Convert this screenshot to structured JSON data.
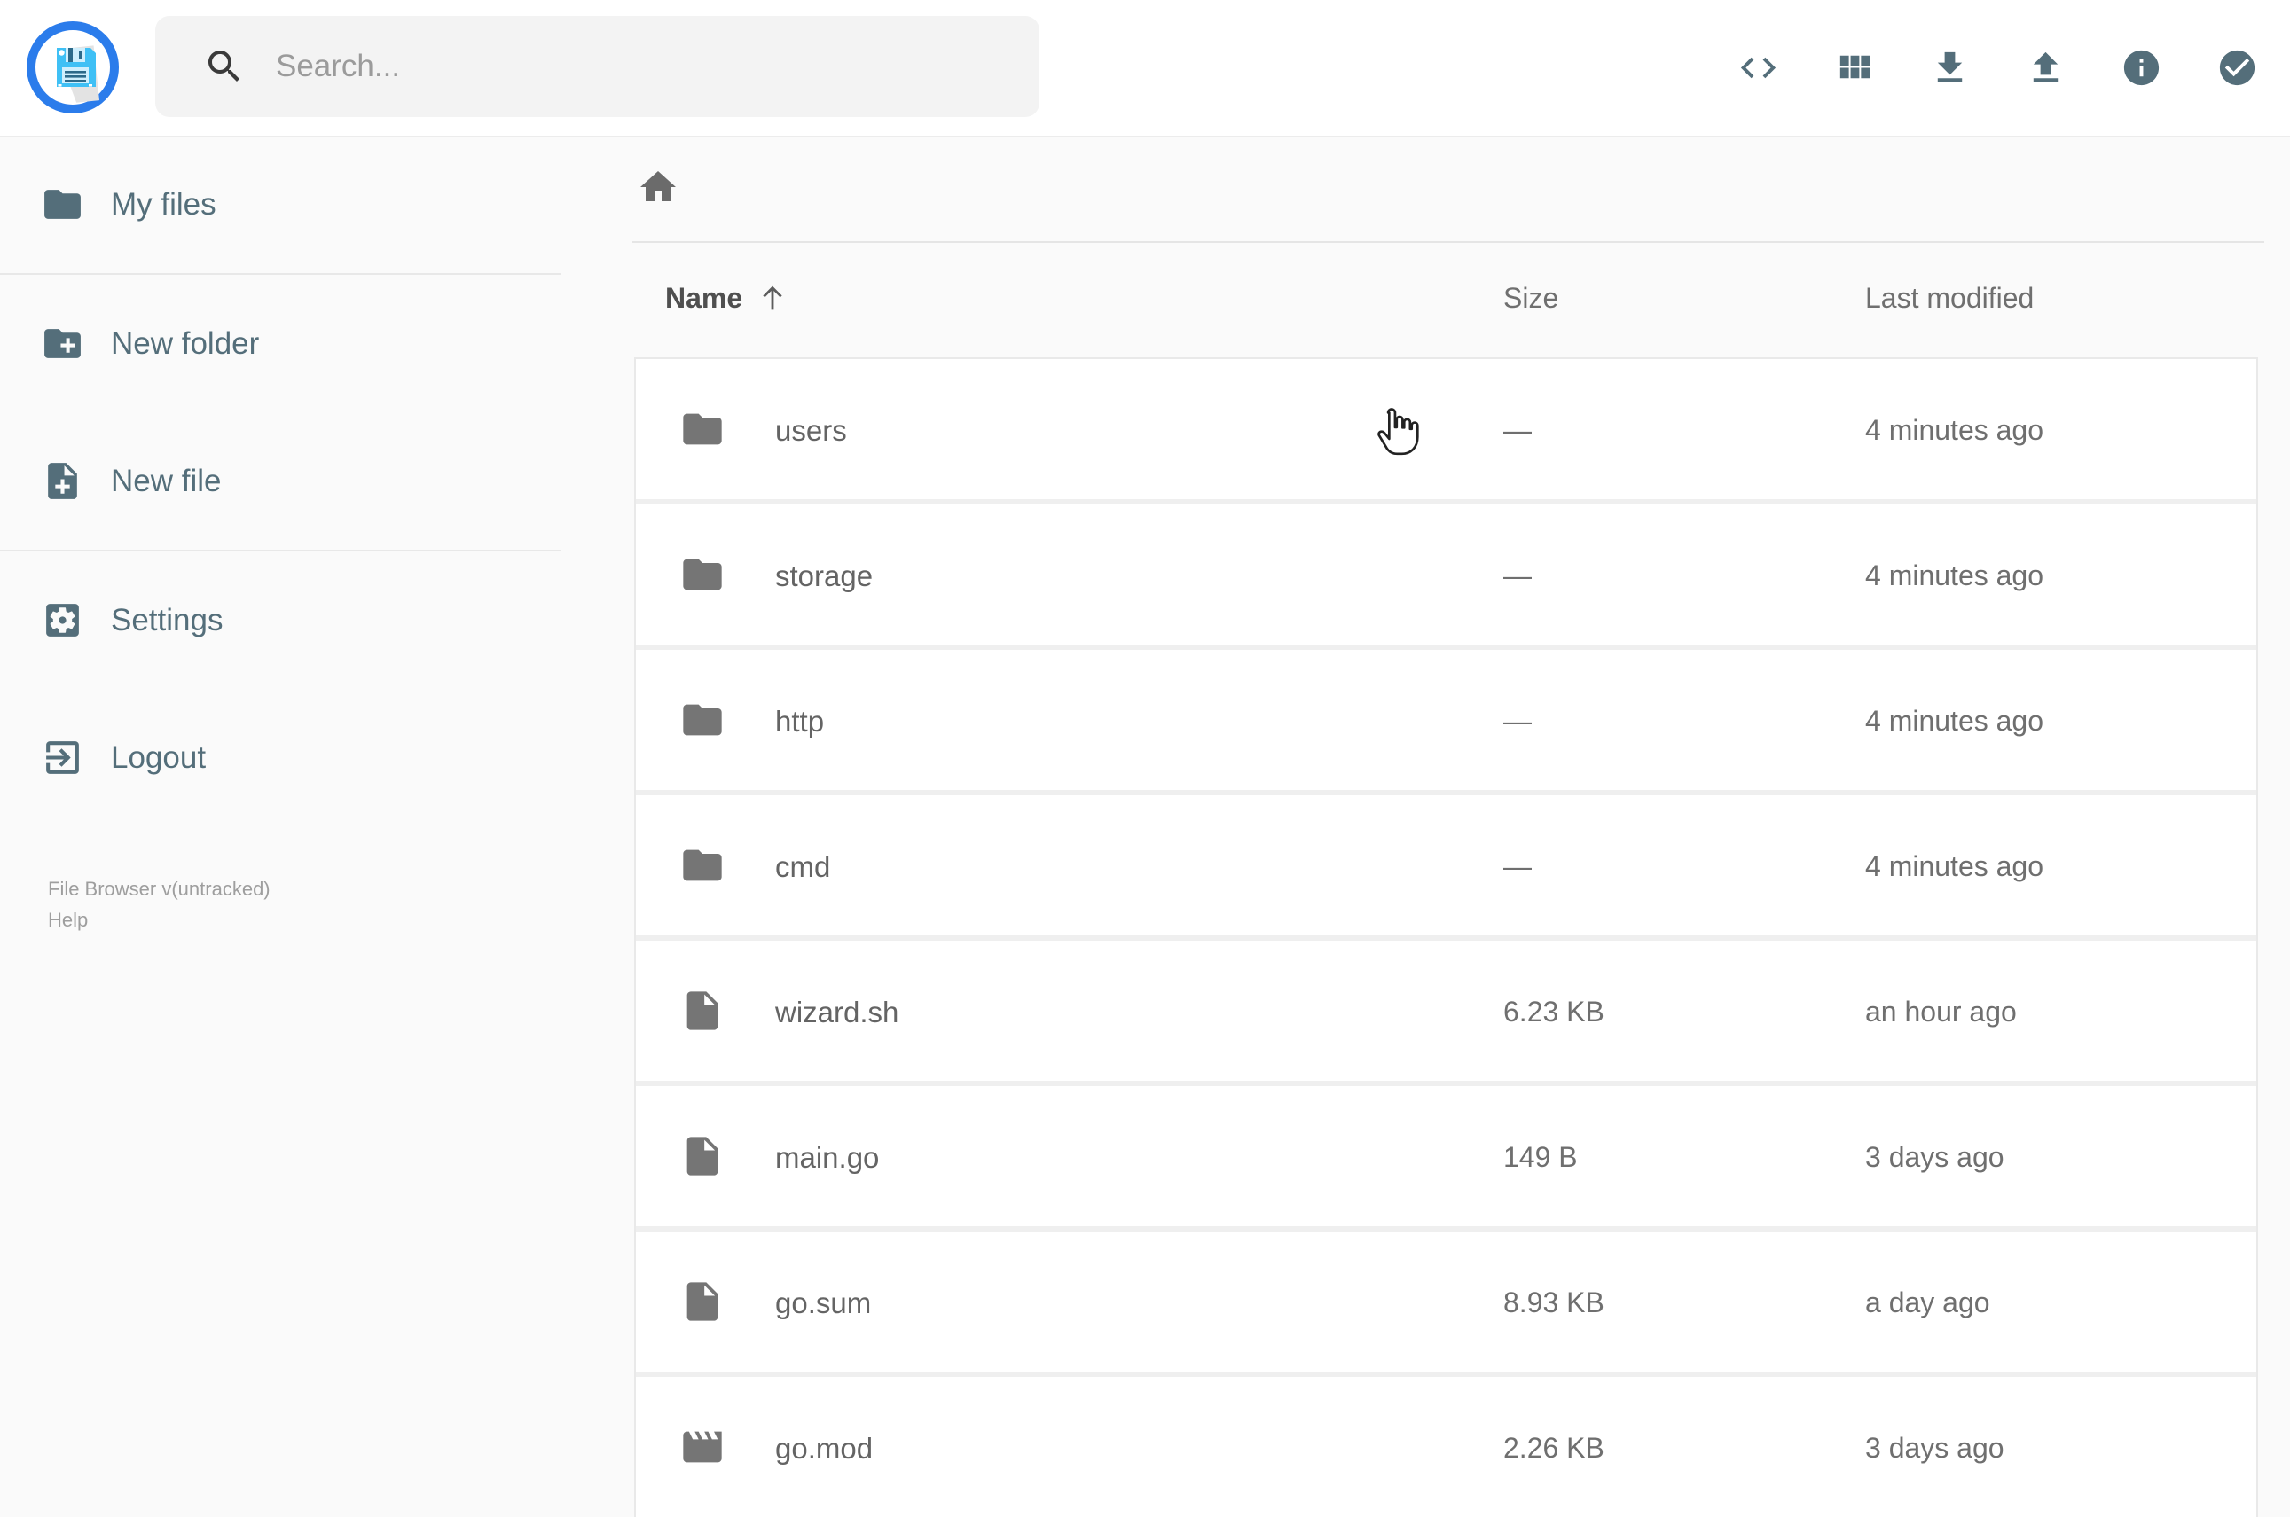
{
  "header": {
    "search": {
      "placeholder": "Search...",
      "value": ""
    },
    "actions": [
      {
        "icon": "code-view-icon"
      },
      {
        "icon": "grid-view-icon"
      },
      {
        "icon": "download-icon"
      },
      {
        "icon": "upload-icon"
      },
      {
        "icon": "info-icon"
      },
      {
        "icon": "select-multiple-icon"
      }
    ],
    "accent_color": "#2b7ceb",
    "icon_color": "#546e7a"
  },
  "sidebar": {
    "items": [
      {
        "label": "My files",
        "icon": "folder-icon"
      },
      {
        "label": "New folder",
        "icon": "create-new-folder-icon"
      },
      {
        "label": "New file",
        "icon": "new-file-icon"
      },
      {
        "label": "Settings",
        "icon": "settings-icon"
      },
      {
        "label": "Logout",
        "icon": "logout-icon"
      }
    ],
    "footer": {
      "version": "File Browser v(untracked)",
      "help": "Help"
    }
  },
  "listing": {
    "columns": {
      "name": "Name",
      "size": "Size",
      "modified": "Last modified"
    },
    "sort": {
      "column": "name",
      "direction": "asc"
    },
    "rows": [
      {
        "name": "users",
        "icon": "folder",
        "size": "—",
        "modified": "4 minutes ago"
      },
      {
        "name": "storage",
        "icon": "folder",
        "size": "—",
        "modified": "4 minutes ago"
      },
      {
        "name": "http",
        "icon": "folder",
        "size": "—",
        "modified": "4 minutes ago"
      },
      {
        "name": "cmd",
        "icon": "folder",
        "size": "—",
        "modified": "4 minutes ago"
      },
      {
        "name": "wizard.sh",
        "icon": "file",
        "size": "6.23 KB",
        "modified": "an hour ago"
      },
      {
        "name": "main.go",
        "icon": "file",
        "size": "149 B",
        "modified": "3 days ago"
      },
      {
        "name": "go.sum",
        "icon": "file",
        "size": "8.93 KB",
        "modified": "a day ago"
      },
      {
        "name": "go.mod",
        "icon": "movie",
        "size": "2.26 KB",
        "modified": "3 days ago"
      }
    ]
  }
}
